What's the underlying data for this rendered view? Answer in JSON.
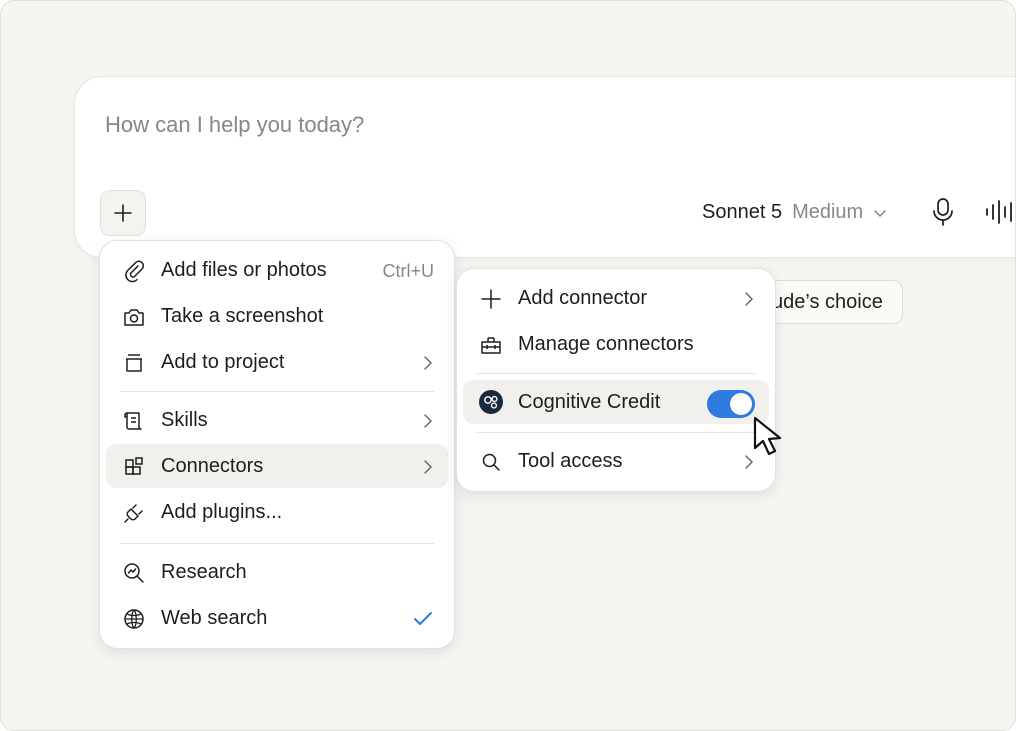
{
  "composer": {
    "placeholder": "How can I help you today?",
    "model_name": "Sonnet 5",
    "model_level": "Medium"
  },
  "suggestion_chip": {
    "label": "ude’s choice"
  },
  "attach_menu": {
    "items": [
      {
        "label": "Add files or photos",
        "shortcut": "Ctrl+U",
        "icon": "paperclip-icon"
      },
      {
        "label": "Take a screenshot",
        "icon": "camera-icon"
      },
      {
        "label": "Add to project",
        "icon": "project-icon"
      },
      {
        "label": "Skills",
        "icon": "scroll-icon"
      },
      {
        "label": "Connectors",
        "icon": "connectors-icon"
      },
      {
        "label": "Add plugins...",
        "icon": "plug-icon"
      },
      {
        "label": "Research",
        "icon": "research-icon"
      },
      {
        "label": "Web search",
        "icon": "globe-icon",
        "checked": true
      }
    ]
  },
  "connectors_menu": {
    "items": [
      {
        "label": "Add connector",
        "icon": "plus-icon"
      },
      {
        "label": "Manage connectors",
        "icon": "toolbox-icon"
      },
      {
        "label": "Cognitive Credit",
        "icon": "connector-avatar",
        "enabled": true
      },
      {
        "label": "Tool access",
        "icon": "search-icon"
      }
    ]
  },
  "colors": {
    "accent": "#2f7be0",
    "background": "#f6f5f2",
    "menu_hover": "#f1f0ec"
  }
}
